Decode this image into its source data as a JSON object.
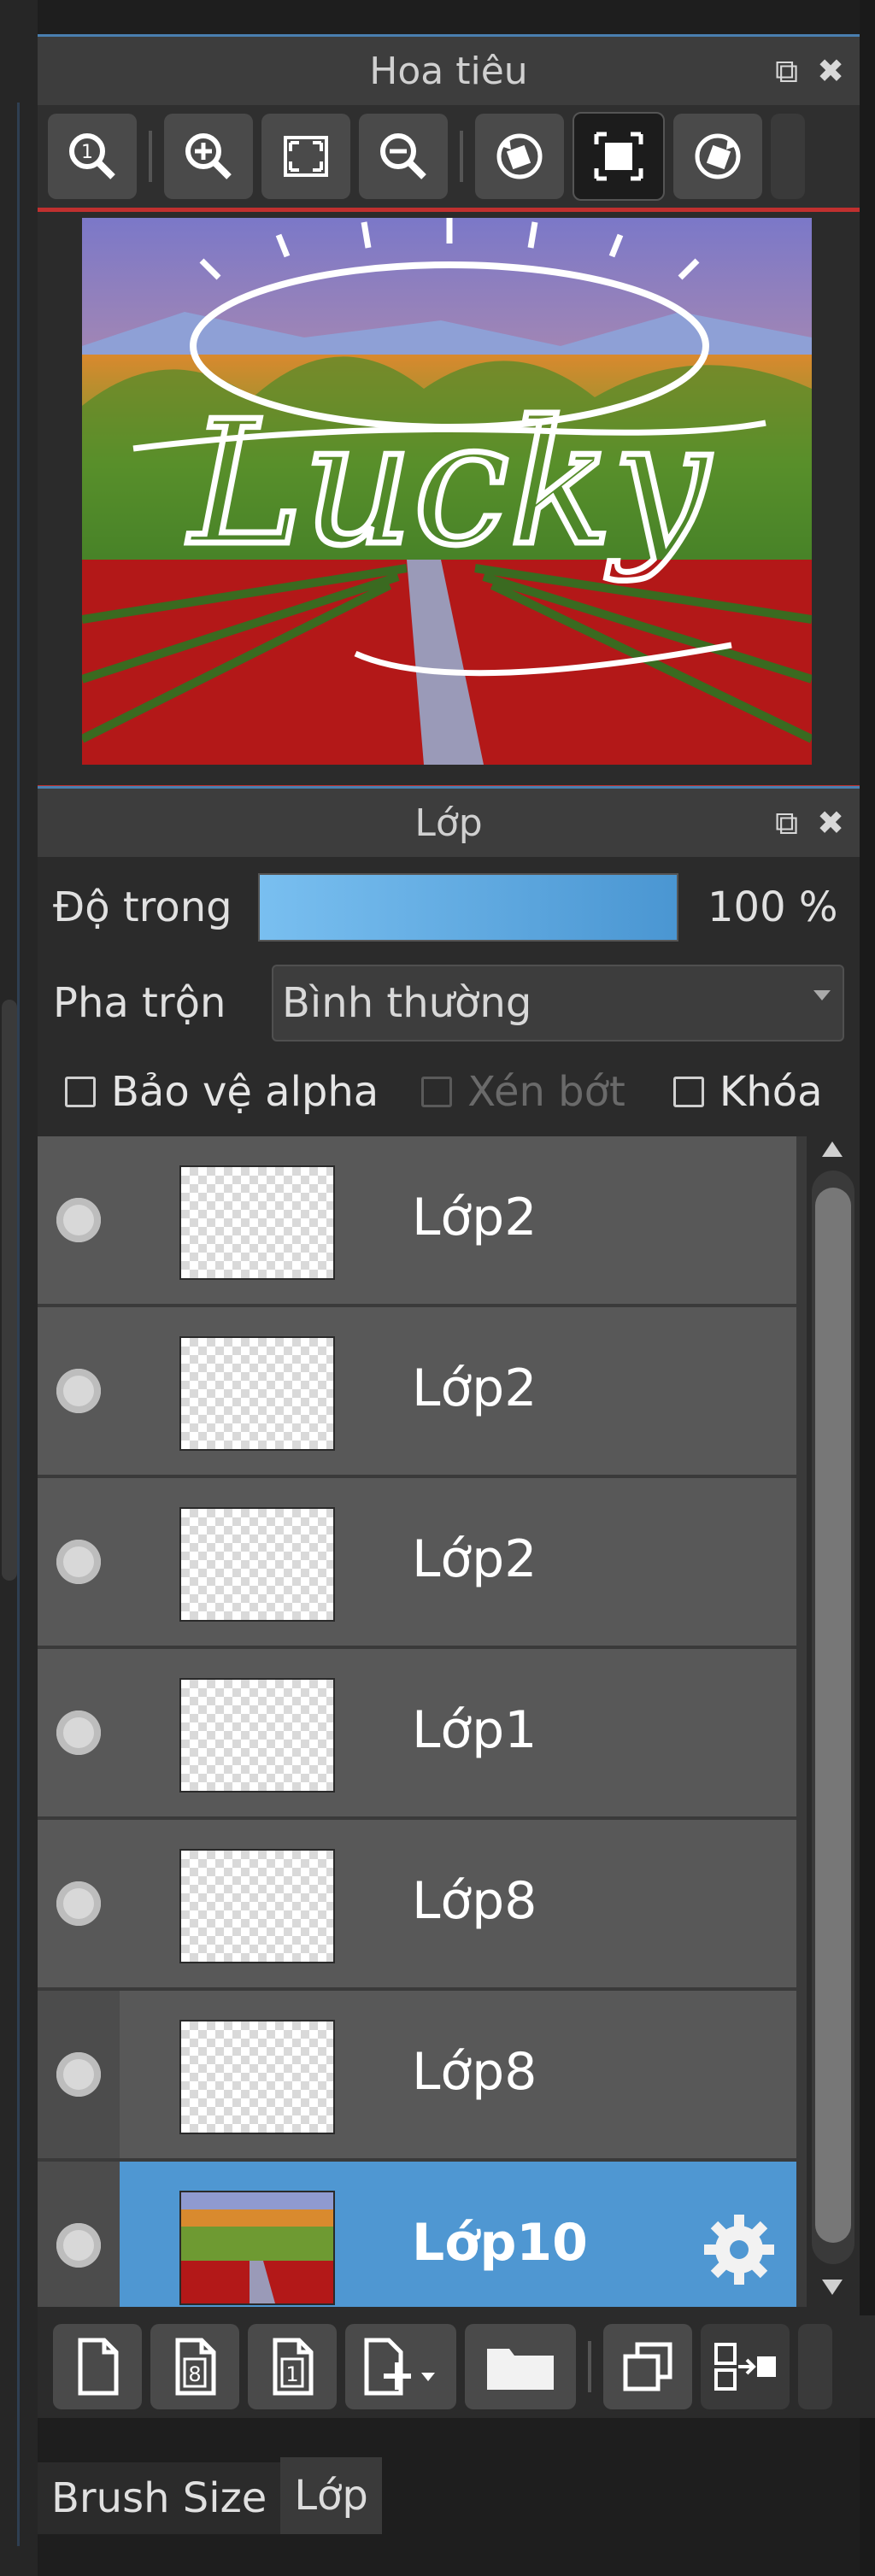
{
  "navigator": {
    "title": "Hoa tiêu",
    "toolbar_icons": [
      "zoom-actual-icon",
      "zoom-in-icon",
      "fit-screen-icon",
      "zoom-out-icon",
      "rotate-left-icon",
      "fit-canvas-icon",
      "rotate-right-icon"
    ]
  },
  "layers_panel": {
    "title": "Lớp",
    "opacity_label": "Độ trong",
    "opacity_value": "100 %",
    "opacity_fraction": 1.0,
    "blend_label": "Pha trộn",
    "blend_value": "Bình thường",
    "checkboxes": [
      {
        "label": "Bảo vệ alpha",
        "checked": false,
        "enabled": true
      },
      {
        "label": "Xén bớt",
        "checked": false,
        "enabled": false
      },
      {
        "label": "Khóa",
        "checked": false,
        "enabled": true
      }
    ],
    "layers": [
      {
        "name": "Lớp2",
        "selected": false,
        "indented": false
      },
      {
        "name": "Lớp2",
        "selected": false,
        "indented": false
      },
      {
        "name": "Lớp2",
        "selected": false,
        "indented": false
      },
      {
        "name": "Lớp1",
        "selected": false,
        "indented": false
      },
      {
        "name": "Lớp8",
        "selected": false,
        "indented": false
      },
      {
        "name": "Lớp8",
        "selected": false,
        "indented": true
      },
      {
        "name": "Lớp10",
        "selected": true,
        "indented": true
      }
    ],
    "bottom_tool_icons": [
      "new-layer-icon",
      "new-8bit-layer-icon",
      "new-1bit-layer-icon",
      "add-layer-dropdown-icon",
      "new-folder-icon",
      "duplicate-layer-icon",
      "merge-down-icon"
    ]
  },
  "tabs": [
    {
      "label": "Brush Size",
      "active": false
    },
    {
      "label": "Lớp",
      "active": true
    }
  ],
  "colors": {
    "accent": "#4f97d2",
    "panel_bg": "#2b2b2b",
    "title_bg": "#3d3d3d",
    "nav_border": "#c0302f"
  }
}
